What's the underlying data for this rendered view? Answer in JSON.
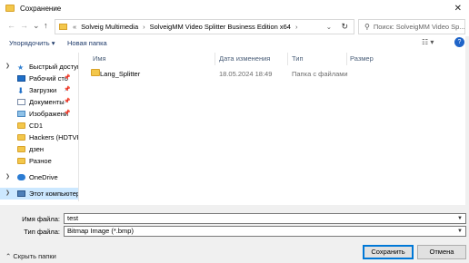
{
  "window": {
    "title": "Сохранение",
    "close": "✕"
  },
  "address": {
    "nav_back": "←",
    "nav_forward": "→",
    "nav_recent": "⌄",
    "nav_up": "↑",
    "overflow": "«",
    "crumbs": [
      "Solveig Multimedia",
      "SolveigMM Video Splitter Business Edition x64"
    ],
    "sep": "›",
    "dropdown": "⌄",
    "refresh": "↻"
  },
  "search": {
    "placeholder": "Поиск: SolveigMM Video Sp...",
    "icon": "search-icon"
  },
  "toolbar": {
    "organize": "Упорядочить ▾",
    "new_folder": "Новая папка",
    "view": "☷ ▾",
    "help": "?"
  },
  "sidebar": {
    "items": [
      {
        "label": "Быстрый доступ",
        "icon": "star-icon",
        "pinned": false
      },
      {
        "label": "Рабочий сто",
        "icon": "desktop-icon",
        "pinned": true
      },
      {
        "label": "Загрузки",
        "icon": "downloads-icon",
        "pinned": true
      },
      {
        "label": "Документы",
        "icon": "documents-icon",
        "pinned": true
      },
      {
        "label": "Изображени",
        "icon": "pictures-icon",
        "pinned": true
      },
      {
        "label": "CD1",
        "icon": "folder-icon",
        "pinned": false
      },
      {
        "label": "Hackers (HDTVR",
        "icon": "folder-icon",
        "pinned": false
      },
      {
        "label": "дзен",
        "icon": "folder-icon",
        "pinned": false
      },
      {
        "label": "Разное",
        "icon": "folder-icon",
        "pinned": false
      },
      {
        "label": "OneDrive",
        "icon": "onedrive-icon",
        "pinned": false
      },
      {
        "label": "Этот компьютер",
        "icon": "computer-icon",
        "pinned": false
      }
    ]
  },
  "columns": {
    "name": "Имя",
    "date": "Дата изменения",
    "type": "Тип",
    "size": "Размер"
  },
  "files": [
    {
      "name": "Lang_Splitter",
      "date": "18.05.2024 18:49",
      "type": "Папка с файлами",
      "size": ""
    }
  ],
  "form": {
    "filename_label": "Имя файла:",
    "filename_value": "test",
    "filetype_label": "Тип файла:",
    "filetype_value": "Bitmap Image (*.bmp)"
  },
  "footer": {
    "hide_folders": "Скрыть папки",
    "save": "Сохранить",
    "cancel": "Отмена"
  }
}
